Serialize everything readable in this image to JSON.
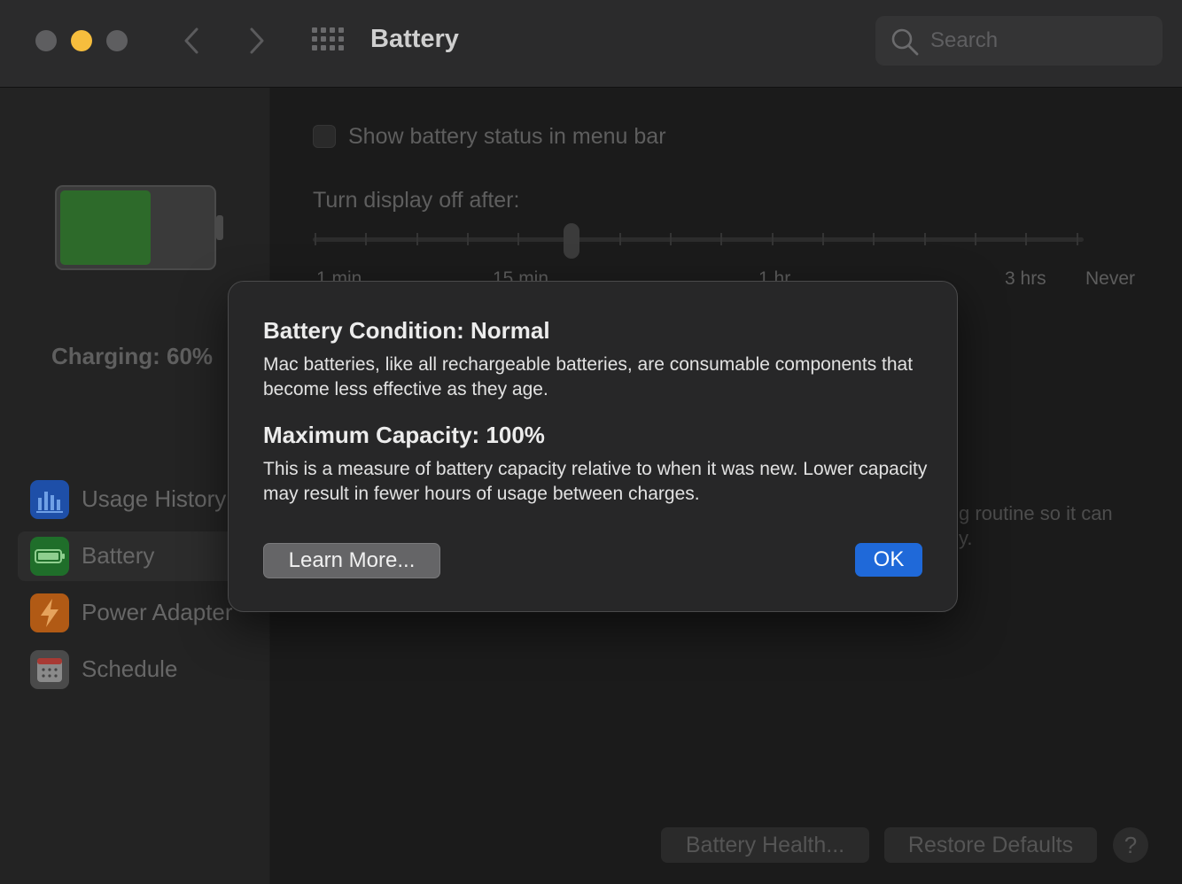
{
  "window": {
    "title": "Battery",
    "search_placeholder": "Search"
  },
  "sidebar": {
    "battery_level": 0.6,
    "charging_text": "Charging: 60%",
    "items": [
      {
        "label": "Usage History",
        "icon": "bar-chart-icon",
        "color": "#1e4fa8"
      },
      {
        "label": "Battery",
        "icon": "battery-icon",
        "color": "#1f6e2a",
        "selected": true
      },
      {
        "label": "Power Adapter",
        "icon": "lightning-bolt-icon",
        "color": "#b15a15"
      },
      {
        "label": "Schedule",
        "icon": "calendar-icon",
        "color": "#4a4a4a"
      }
    ]
  },
  "main": {
    "show_status_label": "Show battery status in menu bar",
    "display_off_label": "Turn display off after:",
    "slider_ticks": [
      "1 min",
      "15 min",
      "1 hr",
      "3 hrs",
      "Never"
    ],
    "background_text_line1": "g routine so it can",
    "background_text_line2": "y.",
    "battery_health_button": "Battery Health...",
    "restore_defaults_button": "Restore Defaults",
    "help_button": "?"
  },
  "dialog": {
    "condition_heading": "Battery Condition: Normal",
    "condition_body": "Mac batteries, like all rechargeable batteries, are consumable components that become less effective as they age.",
    "capacity_heading": "Maximum Capacity: 100%",
    "capacity_body": "This is a measure of battery capacity relative to when it was new. Lower capacity may result in fewer hours of usage between charges.",
    "learn_more_button": "Learn More...",
    "ok_button": "OK"
  },
  "colors": {
    "accent": "#1f69d9",
    "traffic_minimize": "#f6bd3d"
  }
}
